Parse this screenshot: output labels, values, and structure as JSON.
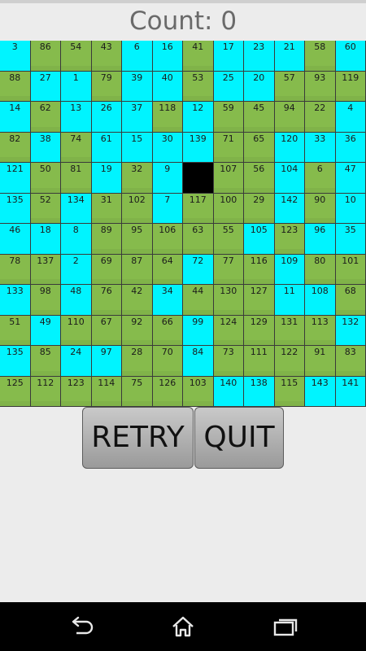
{
  "header": {
    "count_text": "Count: 0"
  },
  "board": {
    "size": 12,
    "colors": {
      "green": "#86bb4c",
      "cyan": "#00f4ff",
      "blank": "#000000"
    },
    "blank_label": "",
    "tiles": [
      [
        "3",
        "c"
      ],
      [
        "86",
        "g"
      ],
      [
        "54",
        "g"
      ],
      [
        "43",
        "g"
      ],
      [
        "6",
        "c"
      ],
      [
        "16",
        "c"
      ],
      [
        "41",
        "g"
      ],
      [
        "17",
        "c"
      ],
      [
        "23",
        "c"
      ],
      [
        "21",
        "c"
      ],
      [
        "58",
        "g"
      ],
      [
        "60",
        "c"
      ],
      [
        "88",
        "g"
      ],
      [
        "27",
        "c"
      ],
      [
        "1",
        "c"
      ],
      [
        "79",
        "g"
      ],
      [
        "39",
        "c"
      ],
      [
        "40",
        "c"
      ],
      [
        "53",
        "g"
      ],
      [
        "25",
        "c"
      ],
      [
        "20",
        "c"
      ],
      [
        "57",
        "g"
      ],
      [
        "93",
        "g"
      ],
      [
        "119",
        "g"
      ],
      [
        "14",
        "c"
      ],
      [
        "62",
        "g"
      ],
      [
        "13",
        "c"
      ],
      [
        "26",
        "c"
      ],
      [
        "37",
        "c"
      ],
      [
        "118",
        "g"
      ],
      [
        "12",
        "c"
      ],
      [
        "59",
        "g"
      ],
      [
        "45",
        "g"
      ],
      [
        "94",
        "g"
      ],
      [
        "22",
        "g"
      ],
      [
        "4",
        "c"
      ],
      [
        "82",
        "g"
      ],
      [
        "38",
        "c"
      ],
      [
        "74",
        "g"
      ],
      [
        "61",
        "c"
      ],
      [
        "15",
        "c"
      ],
      [
        "30",
        "c"
      ],
      [
        "139",
        "c"
      ],
      [
        "71",
        "g"
      ],
      [
        "65",
        "g"
      ],
      [
        "120",
        "c"
      ],
      [
        "33",
        "c"
      ],
      [
        "36",
        "c"
      ],
      [
        "121",
        "c"
      ],
      [
        "50",
        "g"
      ],
      [
        "81",
        "g"
      ],
      [
        "19",
        "c"
      ],
      [
        "32",
        "g"
      ],
      [
        "9",
        "c"
      ],
      [
        "",
        "b"
      ],
      [
        "107",
        "g"
      ],
      [
        "56",
        "g"
      ],
      [
        "104",
        "c"
      ],
      [
        "6",
        "g"
      ],
      [
        "47",
        "c"
      ],
      [
        "135",
        "c"
      ],
      [
        "52",
        "g"
      ],
      [
        "134",
        "c"
      ],
      [
        "31",
        "g"
      ],
      [
        "102",
        "g"
      ],
      [
        "7",
        "c"
      ],
      [
        "117",
        "g"
      ],
      [
        "100",
        "g"
      ],
      [
        "29",
        "g"
      ],
      [
        "142",
        "c"
      ],
      [
        "90",
        "g"
      ],
      [
        "10",
        "c"
      ],
      [
        "46",
        "c"
      ],
      [
        "18",
        "c"
      ],
      [
        "8",
        "c"
      ],
      [
        "89",
        "g"
      ],
      [
        "95",
        "g"
      ],
      [
        "106",
        "g"
      ],
      [
        "63",
        "g"
      ],
      [
        "55",
        "g"
      ],
      [
        "105",
        "c"
      ],
      [
        "123",
        "g"
      ],
      [
        "96",
        "c"
      ],
      [
        "35",
        "c"
      ],
      [
        "78",
        "g"
      ],
      [
        "137",
        "g"
      ],
      [
        "2",
        "c"
      ],
      [
        "69",
        "g"
      ],
      [
        "87",
        "g"
      ],
      [
        "64",
        "g"
      ],
      [
        "72",
        "c"
      ],
      [
        "77",
        "g"
      ],
      [
        "116",
        "g"
      ],
      [
        "109",
        "c"
      ],
      [
        "80",
        "g"
      ],
      [
        "101",
        "g"
      ],
      [
        "133",
        "c"
      ],
      [
        "98",
        "g"
      ],
      [
        "48",
        "c"
      ],
      [
        "76",
        "g"
      ],
      [
        "42",
        "g"
      ],
      [
        "34",
        "c"
      ],
      [
        "44",
        "g"
      ],
      [
        "130",
        "g"
      ],
      [
        "127",
        "g"
      ],
      [
        "11",
        "c"
      ],
      [
        "108",
        "c"
      ],
      [
        "68",
        "g"
      ],
      [
        "51",
        "g"
      ],
      [
        "49",
        "c"
      ],
      [
        "110",
        "g"
      ],
      [
        "67",
        "g"
      ],
      [
        "92",
        "g"
      ],
      [
        "66",
        "g"
      ],
      [
        "99",
        "c"
      ],
      [
        "124",
        "g"
      ],
      [
        "129",
        "g"
      ],
      [
        "131",
        "g"
      ],
      [
        "113",
        "g"
      ],
      [
        "132",
        "c"
      ],
      [
        "135",
        "c"
      ],
      [
        "85",
        "g"
      ],
      [
        "24",
        "c"
      ],
      [
        "97",
        "c"
      ],
      [
        "28",
        "g"
      ],
      [
        "70",
        "g"
      ],
      [
        "84",
        "c"
      ],
      [
        "73",
        "g"
      ],
      [
        "111",
        "g"
      ],
      [
        "122",
        "g"
      ],
      [
        "91",
        "g"
      ],
      [
        "83",
        "g"
      ],
      [
        "125",
        "g"
      ],
      [
        "112",
        "g"
      ],
      [
        "123",
        "g"
      ],
      [
        "114",
        "g"
      ],
      [
        "75",
        "g"
      ],
      [
        "126",
        "g"
      ],
      [
        "103",
        "g"
      ],
      [
        "140",
        "c"
      ],
      [
        "138",
        "c"
      ],
      [
        "115",
        "g"
      ],
      [
        "143",
        "c"
      ],
      [
        "141",
        "c"
      ]
    ]
  },
  "buttons": {
    "retry_label": "RETRY",
    "quit_label": "QUIT"
  },
  "navbar": {
    "icons": [
      "back-icon",
      "home-icon",
      "recent-apps-icon"
    ]
  }
}
